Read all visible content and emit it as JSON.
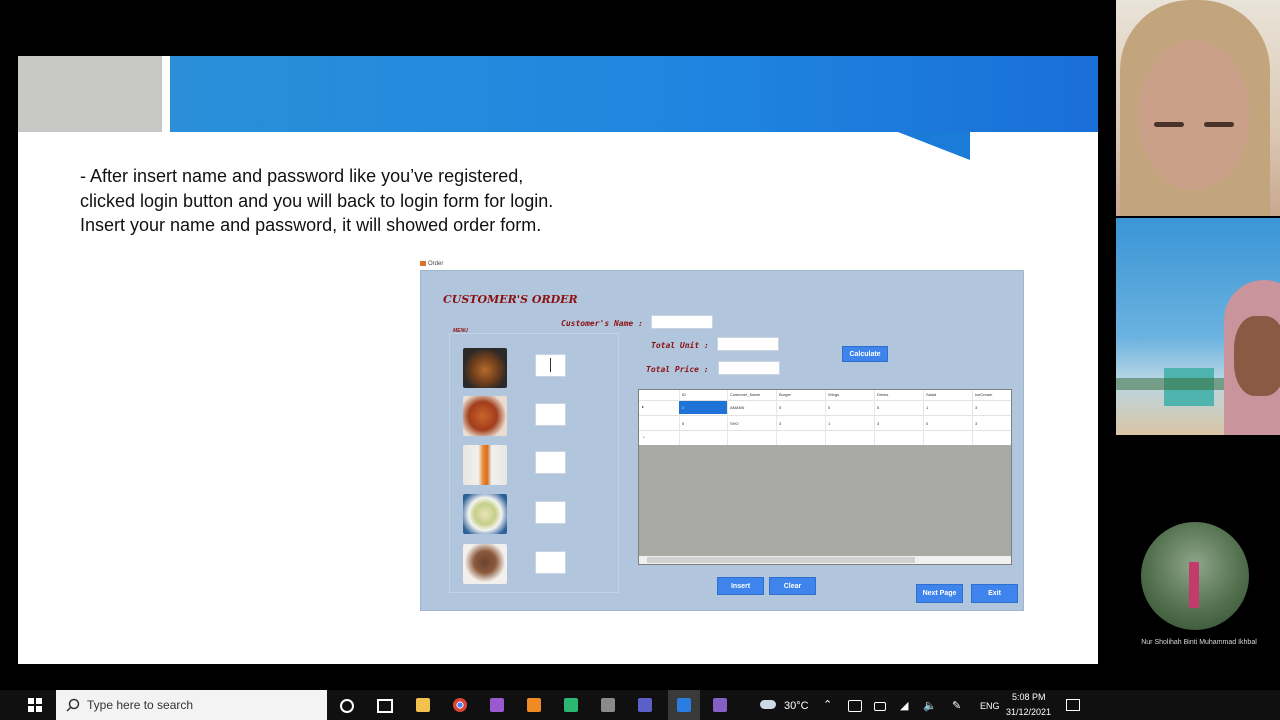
{
  "slide": {
    "body_text": "- After insert name and password like you’ve registered, clicked login button and you will back to login form for login. Insert your name and password, it will showed order form."
  },
  "order_window": {
    "window_title": "Order",
    "form_title": "CUSTOMER'S ORDER",
    "customer_name_label": "Customer's Name :",
    "menu_label": "MENU",
    "total_unit_label": "Total Unit :",
    "total_price_label": "Total Price :",
    "calculate_button": "Calculate",
    "insert_button": "Insert",
    "clear_button": "Clear",
    "next_page_button": "Next Page",
    "exit_button": "Exit",
    "menu_items": [
      {
        "icon": "burger-icon"
      },
      {
        "icon": "wings-icon"
      },
      {
        "icon": "drinks-icon"
      },
      {
        "icon": "salad-icon"
      },
      {
        "icon": "icecream-icon"
      }
    ],
    "grid": {
      "columns": [
        "ID",
        "Customer_Name",
        "Burger",
        "Wings",
        "Drinks",
        "Salad",
        "IceCream"
      ],
      "rows": [
        [
          "2",
          "AMANN",
          "5",
          "5",
          "5",
          "1",
          "3"
        ],
        [
          "5",
          "SHO",
          "3",
          "1",
          "3",
          "0",
          "3"
        ]
      ]
    }
  },
  "participants": {
    "name": "Nur Sholihah Binti Muhammad Ikhbal"
  },
  "taskbar": {
    "search_placeholder": "Type here to search",
    "temperature": "30°C",
    "language": "ENG",
    "time": "5:08 PM",
    "date": "31/12/2021"
  }
}
